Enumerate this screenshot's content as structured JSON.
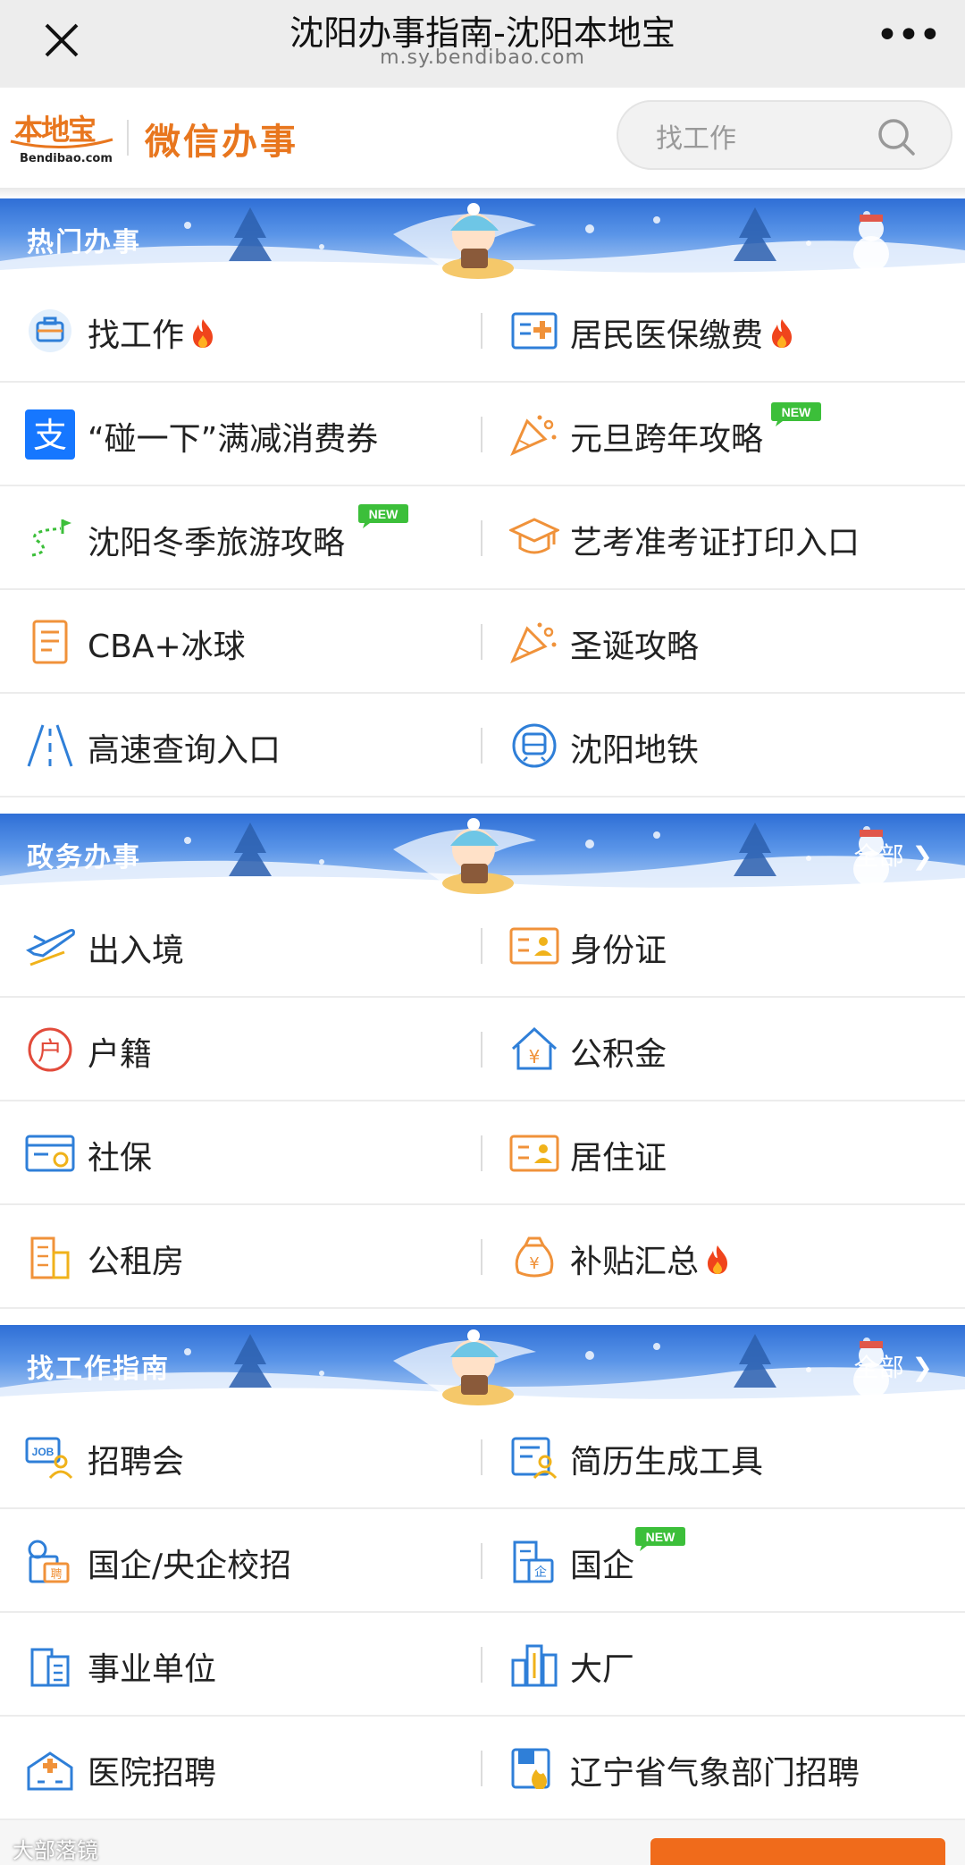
{
  "browser": {
    "title": "沈阳办事指南-沈阳本地宝",
    "url": "m.sy.bendibao.com",
    "more_label": "•••"
  },
  "header": {
    "logo_cn": "本地宝",
    "logo_en": "Bendibao.com",
    "title": "微信办事",
    "search_placeholder": "找工作"
  },
  "sections": {
    "hot": {
      "title": "热门办事",
      "rows": [
        [
          {
            "label": "找工作",
            "icon": "briefcase-icon",
            "hot": true
          },
          {
            "label": "居民医保缴费",
            "icon": "medical-card-icon",
            "hot": true
          }
        ],
        [
          {
            "label": "“碰一下”满减消费券",
            "icon": "alipay-icon"
          },
          {
            "label": "元旦跨年攻略",
            "icon": "party-popper-icon",
            "new": true
          }
        ],
        [
          {
            "label": "沈阳冬季旅游攻略",
            "icon": "route-flag-icon",
            "new": true
          },
          {
            "label": "艺考准考证打印入口",
            "icon": "graduation-cap-icon"
          }
        ],
        [
          {
            "label": "CBA+冰球",
            "icon": "notepad-icon"
          },
          {
            "label": "圣诞攻略",
            "icon": "party-popper-icon"
          }
        ],
        [
          {
            "label": "高速查询入口",
            "icon": "highway-icon"
          },
          {
            "label": "沈阳地铁",
            "icon": "metro-icon"
          }
        ]
      ]
    },
    "gov": {
      "title": "政务办事",
      "more": "全部",
      "rows": [
        [
          {
            "label": "出入境",
            "icon": "airplane-icon"
          },
          {
            "label": "身份证",
            "icon": "id-card-icon"
          }
        ],
        [
          {
            "label": "户籍",
            "icon": "household-icon"
          },
          {
            "label": "公积金",
            "icon": "housing-fund-icon"
          }
        ],
        [
          {
            "label": "社保",
            "icon": "social-security-card-icon"
          },
          {
            "label": "居住证",
            "icon": "residence-permit-icon"
          }
        ],
        [
          {
            "label": "公租房",
            "icon": "building-icon"
          },
          {
            "label": "补贴汇总",
            "icon": "money-bag-icon",
            "hot": true
          }
        ]
      ]
    },
    "jobs": {
      "title": "找工作指南",
      "more": "全部",
      "rows": [
        [
          {
            "label": "招聘会",
            "icon": "job-fair-icon"
          },
          {
            "label": "简历生成工具",
            "icon": "resume-icon"
          }
        ],
        [
          {
            "label": "国企/央企校招",
            "icon": "campus-recruit-icon"
          },
          {
            "label": "国企",
            "icon": "state-enterprise-icon",
            "new": true
          }
        ],
        [
          {
            "label": "事业单位",
            "icon": "institution-icon"
          },
          {
            "label": "大厂",
            "icon": "big-company-icon"
          }
        ],
        [
          {
            "label": "医院招聘",
            "icon": "hospital-icon"
          },
          {
            "label": "辽宁省气象部门招聘",
            "icon": "weather-dept-icon"
          }
        ]
      ]
    }
  },
  "new_tag": "NEW",
  "watermark": "大部落镜",
  "colors": {
    "brand_orange": "#e8761e",
    "icon_blue": "#2f7fd8",
    "icon_orange": "#f0923a",
    "fire_red": "#f0441c",
    "new_green": "#3cbf3a",
    "banner_blue": "#3a7be0"
  }
}
